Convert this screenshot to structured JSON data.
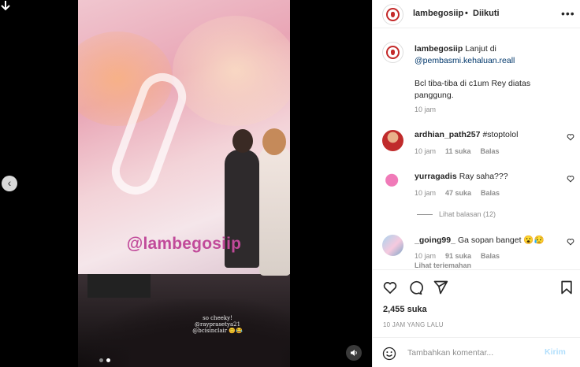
{
  "media": {
    "watermark": "@lambegosiip",
    "overlay_lines": [
      "so cheeky!",
      "@rayprasetya21",
      "@bcisinclair 😊😂"
    ],
    "carousel_count": 2,
    "carousel_active": 1
  },
  "header": {
    "username": "lambegosiip",
    "separator": "•",
    "follow_status": "Diikuti",
    "more_icon": "more-horizontal-icon"
  },
  "caption": {
    "username": "lambegosiip",
    "text_intro": "Lanjut di",
    "mention": "@pembasmi.kehaluan.reall",
    "text_body": "Bcl tiba-tiba di c1um Rey diatas panggung.",
    "time": "10 jam"
  },
  "comments": [
    {
      "username": "ardhian_path257",
      "text": "#stoptolol",
      "time": "10 jam",
      "likes": "11 suka",
      "reply": "Balas"
    },
    {
      "username": "yurragadis",
      "text": "Ray saha???",
      "time": "10 jam",
      "likes": "47 suka",
      "reply": "Balas"
    },
    {
      "username": "_going99_",
      "text": "Ga sopan banget 😮😥",
      "time": "10 jam",
      "likes": "91 suka",
      "reply": "Balas"
    }
  ],
  "view_replies": "Lihat balasan (12)",
  "see_translation": "Lihat terjemahan",
  "likes": "2,455 suka",
  "date": "10 JAM YANG LALU",
  "add_comment": {
    "placeholder": "Tambahkan komentar...",
    "post_label": "Kirim"
  },
  "colors": {
    "mention": "#00376b",
    "secondary_text": "#8e8e8e",
    "post_disabled": "#b2dffc",
    "watermark": "#c14a9a"
  }
}
